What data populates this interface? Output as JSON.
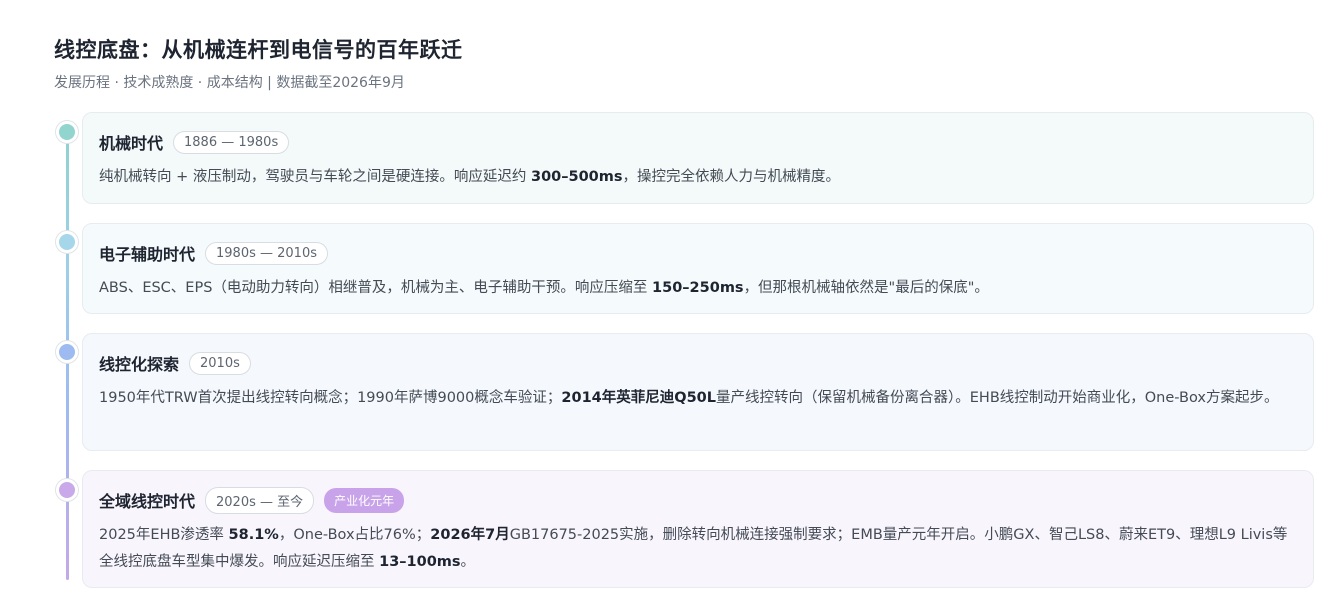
{
  "header": {
    "title": "线控底盘：从机械连杆到电信号的百年跃迁",
    "subtitle": "发展历程 · 技术成熟度 · 成本结构 | 数据截至2026年9月"
  },
  "colors": {
    "era1": "#92d5cf",
    "era2": "#a6d6ea",
    "era3": "#9dbaf1",
    "era4": "#c9a9ea",
    "tag": "#c9a3ea"
  },
  "timeline": [
    {
      "era": "机械时代",
      "years": "1886 — 1980s",
      "desc": [
        "纯机械转向 + 液压制动，驾驶员与车轮之间是硬连接。响应延迟约 ",
        "300–500ms",
        "，操控完全依赖人力与机械精度。"
      ]
    },
    {
      "era": "电子辅助时代",
      "years": "1980s — 2010s",
      "desc": [
        "ABS、ESC、EPS（电动助力转向）相继普及，机械为主、电子辅助干预。响应压缩至 ",
        "150–250ms",
        "，但那根机械轴依然是\"最后的保底\"。"
      ]
    },
    {
      "era": "线控化探索",
      "years": "2010s",
      "desc": [
        "1950年代TRW首次提出线控转向概念；1990年萨博9000概念车验证；",
        "2014年英菲尼迪Q50L",
        "量产线控转向（保留机械备份离合器）。EHB线控制动开始商业化，One-Box方案起步。"
      ]
    },
    {
      "era": "全域线控时代",
      "years": "2020s — 至今",
      "tag": "产业化元年",
      "desc": [
        "2025年EHB渗透率 ",
        "58.1%",
        "，One-Box占比76%；",
        "2026年7月",
        "GB17675-2025实施，删除转向机械连接强制要求；EMB量产元年开启。小鹏GX、智己LS8、蔚来ET9、理想L9 Livis等全线控底盘车型集中爆发。响应延迟压缩至 ",
        "13–100ms",
        "。"
      ]
    }
  ]
}
